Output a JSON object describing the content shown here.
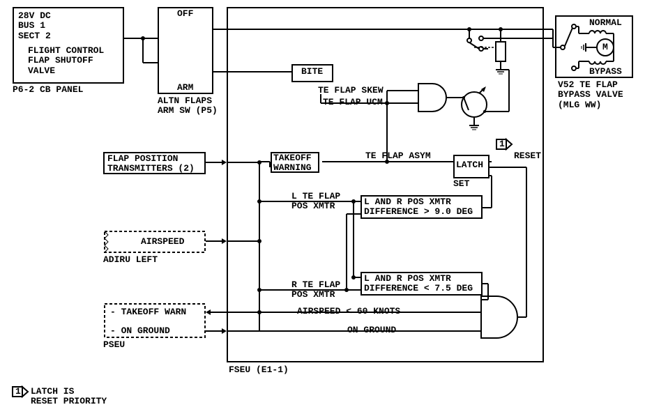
{
  "cb_panel": {
    "lines": "28V DC\nBUS 1\nSECT 2",
    "breaker": "FLIGHT CONTROL\nFLAP SHUTOFF\nVALVE",
    "label": "P6-2 CB PANEL"
  },
  "arm_sw": {
    "off": "OFF",
    "arm": "ARM",
    "label": "ALTN FLAPS\nARM SW (P5)"
  },
  "bite": "BITE",
  "te_flap_skew": "TE FLAP SKEW",
  "te_flap_ucm": "TE FLAP UCM",
  "bypass_valve": {
    "normal": "NORMAL",
    "bypass": "BYPASS",
    "label": "V52 TE FLAP\nBYPASS VALVE\n(MLG WW)",
    "motor": "M"
  },
  "xmtr": "FLAP POSITION\nTRANSMITTERS (2)",
  "takeoff_warning": "TAKEOFF\nWARNING",
  "te_flap_asym": "TE FLAP ASYM",
  "latch": "LATCH",
  "reset": "RESET",
  "set": "SET",
  "reset_ref": "1",
  "l_te_flap": "L TE FLAP\nPOS XMTR",
  "r_te_flap": "R TE FLAP\nPOS XMTR",
  "diff_9": "L AND R POS XMTR\nDIFFERENCE > 9.0 DEG",
  "diff_75": "L AND R POS XMTR\nDIFFERENCE < 7.5 DEG",
  "airspeed": "AIRSPEED",
  "adiru": "ADIRU LEFT",
  "pseu_top": "- TAKEOFF WARN",
  "pseu_bot": "- ON GROUND",
  "pseu_label": "PSEU",
  "airspeed_60": "AIRSPEED < 60 KNOTS",
  "on_ground": "ON GROUND",
  "fseu": "FSEU (E1-1)",
  "footnote": "LATCH IS\nRESET PRIORITY",
  "footnote_ref": "1"
}
